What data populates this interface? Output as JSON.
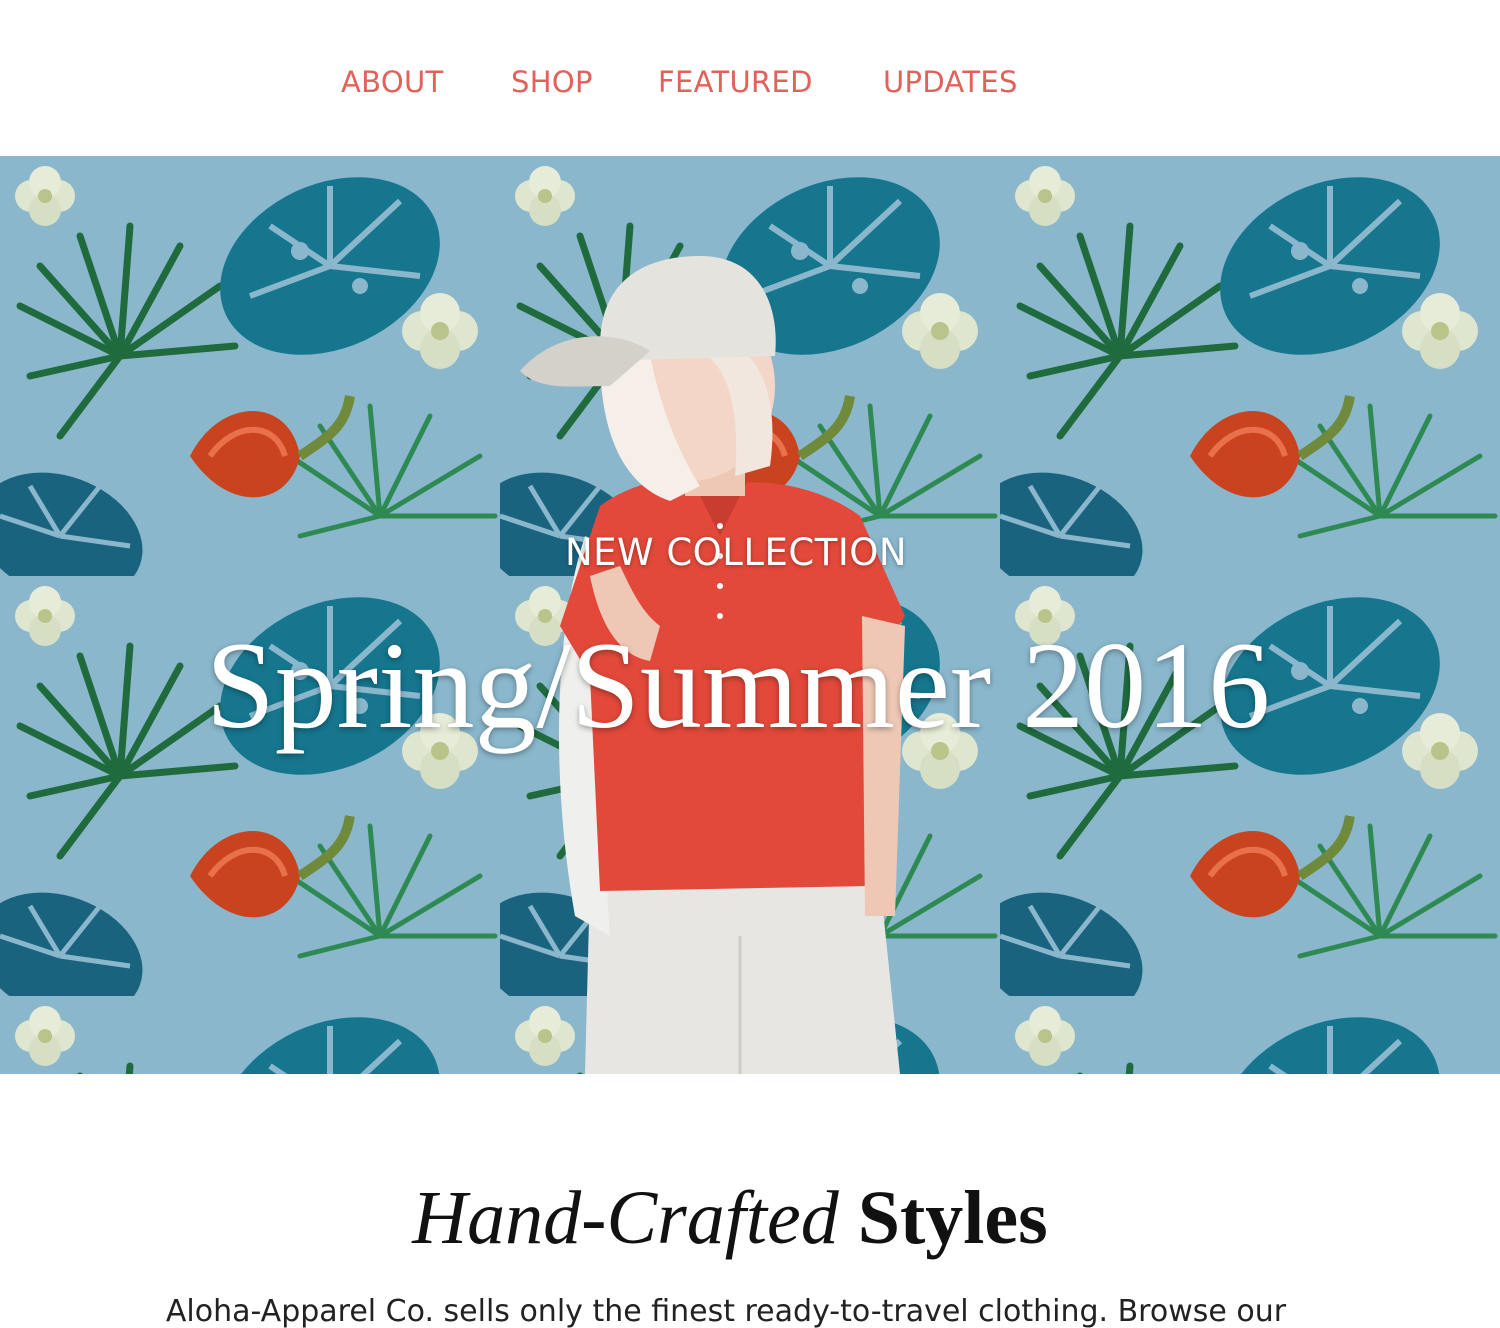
{
  "nav": {
    "items": [
      {
        "label": "ABOUT"
      },
      {
        "label": "SHOP"
      },
      {
        "label": "FEATURED"
      },
      {
        "label": "UPDATES"
      }
    ]
  },
  "hero": {
    "kicker": "NEW COLLECTION",
    "title": "Spring/Summer 2016"
  },
  "content": {
    "heading_italic": "Hand-Crafted",
    "heading_bold": "Styles",
    "intro": "Aloha-Apparel Co. sells only the finest ready-to-travel clothing. Browse our"
  },
  "colors": {
    "nav_link": "#e0625a",
    "hero_bg": "#8ab7cc",
    "hero_text": "#ffffff",
    "heading_text": "#111111",
    "body_text": "#222222"
  }
}
